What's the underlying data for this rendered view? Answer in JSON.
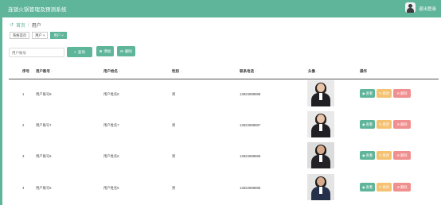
{
  "app": {
    "title": "连锁火锅管理及预测系统",
    "logout_label": "退出登录"
  },
  "breadcrumb": {
    "home": "首页",
    "separator": "/",
    "current": "用户"
  },
  "tabs": [
    {
      "label": "系统首页",
      "active": false
    },
    {
      "label": "用户 ×",
      "active": false
    },
    {
      "label": "用户 ×",
      "active": true
    }
  ],
  "toolbar": {
    "search_placeholder": "用户账号",
    "query_label": "查询",
    "add_label": "添加",
    "delete_label": "删除"
  },
  "table": {
    "headers": [
      "序号",
      "用户账号",
      "用户姓名",
      "性别",
      "联系电话",
      "头像",
      "操作"
    ],
    "rows": [
      {
        "index": "1",
        "account": "用户账号8",
        "name": "用户姓名8",
        "gender": "男",
        "phone": "13823888888",
        "photo": "woman-dark-suit"
      },
      {
        "index": "2",
        "account": "用户账号7",
        "name": "用户姓名7",
        "gender": "男",
        "phone": "13823888887",
        "photo": "woman-dark-suit"
      },
      {
        "index": "3",
        "account": "用户账号6",
        "name": "用户姓名6",
        "gender": "男",
        "phone": "13823888886",
        "photo": "man-dark-suit"
      },
      {
        "index": "4",
        "account": "用户账号5",
        "name": "用户姓名5",
        "gender": "男",
        "phone": "13823888885",
        "photo": "man-navy-suit"
      }
    ],
    "actions": {
      "view": "查看",
      "edit": "修改",
      "delete": "删除"
    }
  },
  "colors": {
    "primary": "#5fb59a",
    "edit": "#f4c270",
    "delete": "#f08f8f"
  }
}
